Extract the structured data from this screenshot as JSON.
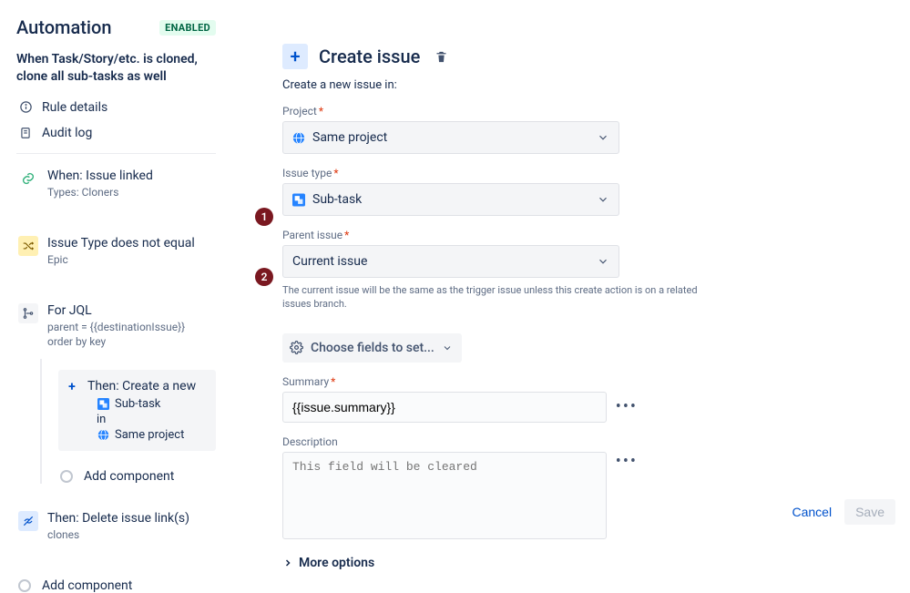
{
  "sidebar": {
    "title": "Automation",
    "status_badge": "ENABLED",
    "description": "When Task/Story/etc. is cloned, clone all sub-tasks as well",
    "links": {
      "rule_details": "Rule details",
      "audit_log": "Audit log"
    },
    "nodes": {
      "trigger": {
        "title": "When: Issue linked",
        "subtitle": "Types: Cloners"
      },
      "condition": {
        "title": "Issue Type does not equal",
        "subtitle": "Epic"
      },
      "branch": {
        "title": "For JQL",
        "subtitle": "parent = {{destinationIssue}} order by key"
      },
      "then_create": {
        "title": "Then: Create a new",
        "line_subtask": "Sub-task",
        "line_in": "in",
        "line_project": "Same project"
      },
      "then_delete": {
        "title": "Then: Delete issue link(s)",
        "subtitle": "clones"
      },
      "add_component": "Add component"
    }
  },
  "panel": {
    "title": "Create issue",
    "subtitle": "Create a new issue in:",
    "fields": {
      "project": {
        "label": "Project",
        "value": "Same project"
      },
      "issue_type": {
        "label": "Issue type",
        "value": "Sub-task"
      },
      "parent_issue": {
        "label": "Parent issue",
        "value": "Current issue",
        "helper": "The current issue will be the same as the trigger issue unless this create action is on a related issues branch."
      },
      "chooser": "Choose fields to set...",
      "summary": {
        "label": "Summary",
        "value": "{{issue.summary}}"
      },
      "description": {
        "label": "Description",
        "placeholder": "This field will be cleared"
      }
    },
    "more_options": "More options",
    "buttons": {
      "cancel": "Cancel",
      "save": "Save"
    }
  },
  "callouts": {
    "one": "1",
    "two": "2"
  }
}
